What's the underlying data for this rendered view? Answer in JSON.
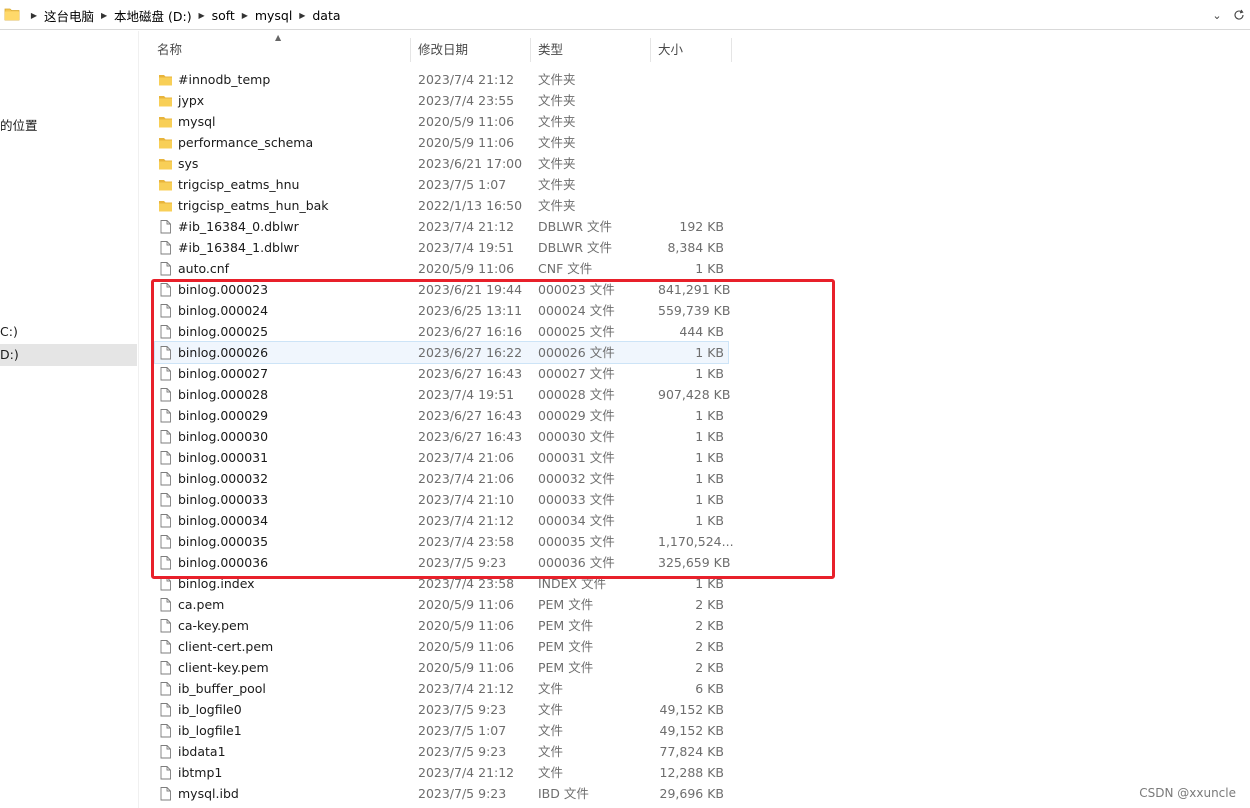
{
  "address": {
    "path": [
      "这台电脑",
      "本地磁盘 (D:)",
      "soft",
      "mysql",
      "data"
    ]
  },
  "navpane": {
    "items": [
      "的位置",
      "C:)",
      "D:)"
    ]
  },
  "columns": {
    "name": "名称",
    "date": "修改日期",
    "type": "类型",
    "size": "大小"
  },
  "files": [
    {
      "name": "#innodb_temp",
      "date": "2023/7/4 21:12",
      "type": "文件夹",
      "size": "",
      "icon": "folder-icon"
    },
    {
      "name": "jypx",
      "date": "2023/7/4 23:55",
      "type": "文件夹",
      "size": "",
      "icon": "folder-icon"
    },
    {
      "name": "mysql",
      "date": "2020/5/9 11:06",
      "type": "文件夹",
      "size": "",
      "icon": "folder-icon"
    },
    {
      "name": "performance_schema",
      "date": "2020/5/9 11:06",
      "type": "文件夹",
      "size": "",
      "icon": "folder-icon"
    },
    {
      "name": "sys",
      "date": "2023/6/21 17:00",
      "type": "文件夹",
      "size": "",
      "icon": "folder-icon"
    },
    {
      "name": "trigcisp_eatms_hnu",
      "date": "2023/7/5 1:07",
      "type": "文件夹",
      "size": "",
      "icon": "folder-icon"
    },
    {
      "name": "trigcisp_eatms_hun_bak",
      "date": "2022/1/13 16:50",
      "type": "文件夹",
      "size": "",
      "icon": "folder-icon"
    },
    {
      "name": "#ib_16384_0.dblwr",
      "date": "2023/7/4 21:12",
      "type": "DBLWR 文件",
      "size": "192 KB",
      "icon": "file-icon"
    },
    {
      "name": "#ib_16384_1.dblwr",
      "date": "2023/7/4 19:51",
      "type": "DBLWR 文件",
      "size": "8,384 KB",
      "icon": "file-icon"
    },
    {
      "name": "auto.cnf",
      "date": "2020/5/9 11:06",
      "type": "CNF 文件",
      "size": "1 KB",
      "icon": "file-icon"
    },
    {
      "name": "binlog.000023",
      "date": "2023/6/21 19:44",
      "type": "000023 文件",
      "size": "841,291 KB",
      "icon": "file-icon"
    },
    {
      "name": "binlog.000024",
      "date": "2023/6/25 13:11",
      "type": "000024 文件",
      "size": "559,739 KB",
      "icon": "file-icon"
    },
    {
      "name": "binlog.000025",
      "date": "2023/6/27 16:16",
      "type": "000025 文件",
      "size": "444 KB",
      "icon": "file-icon"
    },
    {
      "name": "binlog.000026",
      "date": "2023/6/27 16:22",
      "type": "000026 文件",
      "size": "1 KB",
      "icon": "file-icon",
      "hover": true
    },
    {
      "name": "binlog.000027",
      "date": "2023/6/27 16:43",
      "type": "000027 文件",
      "size": "1 KB",
      "icon": "file-icon"
    },
    {
      "name": "binlog.000028",
      "date": "2023/7/4 19:51",
      "type": "000028 文件",
      "size": "907,428 KB",
      "icon": "file-icon"
    },
    {
      "name": "binlog.000029",
      "date": "2023/6/27 16:43",
      "type": "000029 文件",
      "size": "1 KB",
      "icon": "file-icon"
    },
    {
      "name": "binlog.000030",
      "date": "2023/6/27 16:43",
      "type": "000030 文件",
      "size": "1 KB",
      "icon": "file-icon"
    },
    {
      "name": "binlog.000031",
      "date": "2023/7/4 21:06",
      "type": "000031 文件",
      "size": "1 KB",
      "icon": "file-icon"
    },
    {
      "name": "binlog.000032",
      "date": "2023/7/4 21:06",
      "type": "000032 文件",
      "size": "1 KB",
      "icon": "file-icon"
    },
    {
      "name": "binlog.000033",
      "date": "2023/7/4 21:10",
      "type": "000033 文件",
      "size": "1 KB",
      "icon": "file-icon"
    },
    {
      "name": "binlog.000034",
      "date": "2023/7/4 21:12",
      "type": "000034 文件",
      "size": "1 KB",
      "icon": "file-icon"
    },
    {
      "name": "binlog.000035",
      "date": "2023/7/4 23:58",
      "type": "000035 文件",
      "size": "1,170,524...",
      "icon": "file-icon"
    },
    {
      "name": "binlog.000036",
      "date": "2023/7/5 9:23",
      "type": "000036 文件",
      "size": "325,659 KB",
      "icon": "file-icon"
    },
    {
      "name": "binlog.index",
      "date": "2023/7/4 23:58",
      "type": "INDEX 文件",
      "size": "1 KB",
      "icon": "file-icon"
    },
    {
      "name": "ca.pem",
      "date": "2020/5/9 11:06",
      "type": "PEM 文件",
      "size": "2 KB",
      "icon": "file-icon"
    },
    {
      "name": "ca-key.pem",
      "date": "2020/5/9 11:06",
      "type": "PEM 文件",
      "size": "2 KB",
      "icon": "file-icon"
    },
    {
      "name": "client-cert.pem",
      "date": "2020/5/9 11:06",
      "type": "PEM 文件",
      "size": "2 KB",
      "icon": "file-icon"
    },
    {
      "name": "client-key.pem",
      "date": "2020/5/9 11:06",
      "type": "PEM 文件",
      "size": "2 KB",
      "icon": "file-icon"
    },
    {
      "name": "ib_buffer_pool",
      "date": "2023/7/4 21:12",
      "type": "文件",
      "size": "6 KB",
      "icon": "file-icon"
    },
    {
      "name": "ib_logfile0",
      "date": "2023/7/5 9:23",
      "type": "文件",
      "size": "49,152 KB",
      "icon": "file-icon"
    },
    {
      "name": "ib_logfile1",
      "date": "2023/7/5 1:07",
      "type": "文件",
      "size": "49,152 KB",
      "icon": "file-icon"
    },
    {
      "name": "ibdata1",
      "date": "2023/7/5 9:23",
      "type": "文件",
      "size": "77,824 KB",
      "icon": "file-icon"
    },
    {
      "name": "ibtmp1",
      "date": "2023/7/4 21:12",
      "type": "文件",
      "size": "12,288 KB",
      "icon": "file-icon"
    },
    {
      "name": "mysql.ibd",
      "date": "2023/7/5 9:23",
      "type": "IBD 文件",
      "size": "29,696 KB",
      "icon": "file-icon"
    }
  ],
  "colors": {
    "highlight": "#e8202a",
    "folder": "#f4c653",
    "hover_row": "#f0f6fd"
  },
  "watermark": "CSDN @xxuncle"
}
